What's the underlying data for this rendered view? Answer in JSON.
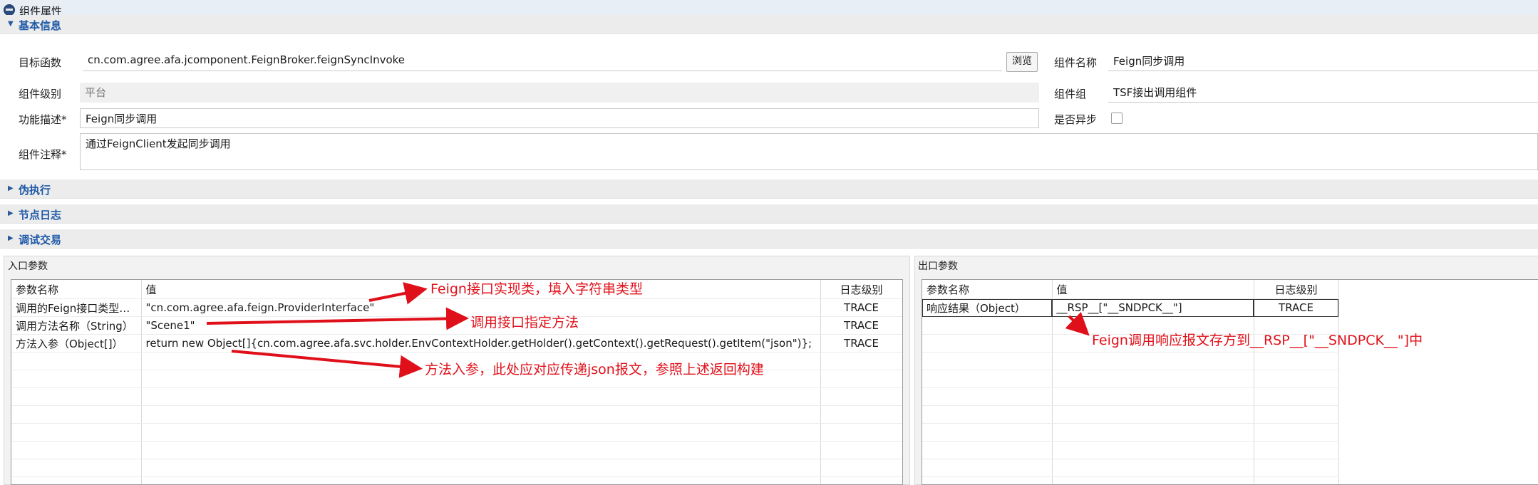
{
  "window": {
    "title": "组件属性"
  },
  "sections": {
    "basic": "基本信息",
    "pseudo": "伪执行",
    "nodelog": "节点日志",
    "debug": "调试交易"
  },
  "basic": {
    "target_func_label": "目标函数",
    "target_func_value": "cn.com.agree.afa.jcomponent.FeignBroker.feignSyncInvoke",
    "browse_label": "浏览",
    "comp_name_label": "组件名称",
    "comp_name_value": "Feign同步调用",
    "comp_level_label": "组件级别",
    "comp_level_value": "平台",
    "comp_group_label": "组件组",
    "comp_group_value": "TSF接出调用组件",
    "func_desc_label": "功能描述*",
    "func_desc_value": "Feign同步调用",
    "async_label": "是否异步",
    "comment_label": "组件注释*",
    "comment_value": "通过FeignClient发起同步调用"
  },
  "input_params": {
    "title": "入口参数",
    "columns": [
      "参数名称",
      "值",
      "日志级别"
    ],
    "rows": [
      [
        "调用的Feign接口类型（...",
        "\"cn.com.agree.afa.feign.ProviderInterface\"",
        "TRACE"
      ],
      [
        "调用方法名称（String）",
        "\"Scene1\"",
        "TRACE"
      ],
      [
        "方法入参（Object[]）",
        "return new Object[]{cn.com.agree.afa.svc.holder.EnvContextHolder.getHolder().getContext().getRequest().getItem(\"json\")};",
        "TRACE"
      ]
    ]
  },
  "output_params": {
    "title": "出口参数",
    "columns": [
      "参数名称",
      "值",
      "日志级别"
    ],
    "rows": [
      [
        "响应结果（Object）",
        "__RSP__[\"__SNDPCK__\"]",
        "TRACE"
      ]
    ]
  },
  "annotations": {
    "a1": "Feign接口实现类，填入字符串类型",
    "a2": "调用接口指定方法",
    "a3": "方法入参，此处应对应传递json报文，参照上述返回构建",
    "a4": "Feign调用响应报文存方到__RSP__[\"__SNDPCK__\"]中"
  },
  "colors": {
    "annotation": "#e0101a",
    "section_label": "#1f5aa8"
  }
}
